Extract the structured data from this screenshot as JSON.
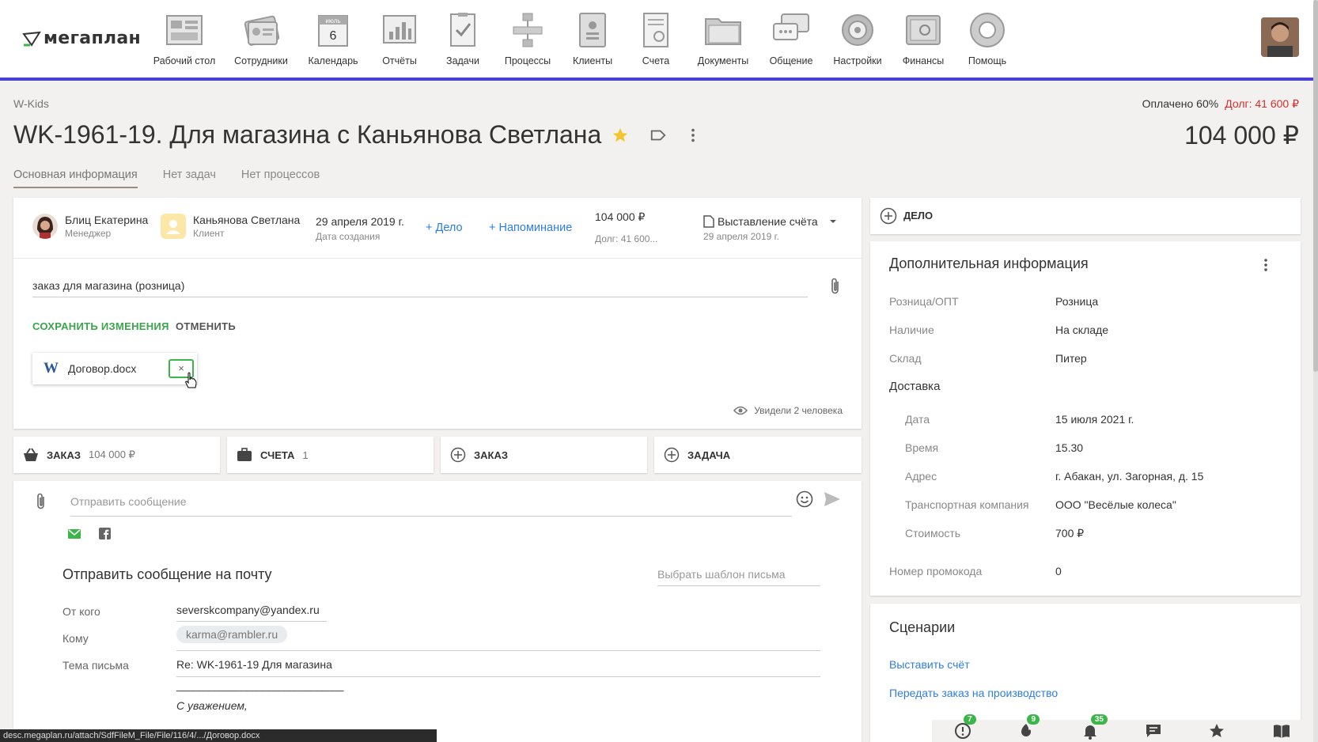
{
  "nav": {
    "logo": "мегаплан",
    "items": [
      {
        "label": "Рабочий стол",
        "icon": "desktop-icon"
      },
      {
        "label": "Сотрудники",
        "icon": "employees-icon"
      },
      {
        "label": "Календарь",
        "icon": "calendar-icon",
        "month": "июль",
        "day": "6"
      },
      {
        "label": "Отчёты",
        "icon": "reports-icon"
      },
      {
        "label": "Задачи",
        "icon": "tasks-icon"
      },
      {
        "label": "Процессы",
        "icon": "processes-icon"
      },
      {
        "label": "Клиенты",
        "icon": "clients-icon"
      },
      {
        "label": "Счета",
        "icon": "invoices-icon"
      },
      {
        "label": "Документы",
        "icon": "documents-icon"
      },
      {
        "label": "Общение",
        "icon": "chat-icon"
      },
      {
        "label": "Настройки",
        "icon": "settings-icon"
      },
      {
        "label": "Финансы",
        "icon": "finance-icon"
      },
      {
        "label": "Помощь",
        "icon": "help-icon"
      }
    ]
  },
  "header": {
    "breadcrumb": "W-Kids",
    "paid": "Оплачено 60%",
    "debt": "Долг: 41 600 ₽",
    "title": "WK-1961-19. Для магазина с Каньянова Светлана",
    "amount": "104 000 ₽"
  },
  "tabs": [
    "Основная информация",
    "Нет задач",
    "Нет процессов"
  ],
  "deal": {
    "manager_name": "Блиц Екатерина",
    "manager_role": "Менеджер",
    "client_name": "Каньянова Светлана",
    "client_role": "Клиент",
    "created_date": "29 апреля 2019 г.",
    "created_label": "Дата создания",
    "add_case": "+ Дело",
    "add_reminder": "+ Напоминание",
    "sum": "104 000 ₽",
    "sum_debt": "Долг: 41 600...",
    "stage": "Выставление счёта",
    "stage_date": "29 апреля 2019 г.",
    "description": "заказ для магазина (розница)",
    "save": "СОХРАНИТЬ ИЗМЕНЕНИЯ",
    "cancel": "ОТМЕНИТЬ",
    "file_name": "Договор.docx",
    "file_remove": "×",
    "seen": "Увидели 2 человека"
  },
  "actions": {
    "order_label": "ЗАКАЗ",
    "order_value": "104 000 ₽",
    "invoices_label": "СЧЕТА",
    "invoices_count": "1",
    "add_order": "ЗАКАЗ",
    "add_task": "ЗАДАЧА"
  },
  "message": {
    "placeholder": "Отправить сообщение",
    "mail_title": "Отправить сообщение на почту",
    "template_placeholder": "Выбрать шаблон письма",
    "from_label": "От кого",
    "from_value": "severskcompany@yandex.ru",
    "to_label": "Кому",
    "to_value": "karma@rambler.ru",
    "subject_label": "Тема письма",
    "subject_value": "Re: WK-1961-19 Для магазина",
    "signature_line": "_______________________________",
    "signature": "С уважением,"
  },
  "right": {
    "case_label": "ДЕЛО",
    "extra_title": "Дополнительная информация",
    "fields": [
      {
        "k": "Розница/ОПТ",
        "v": "Розница"
      },
      {
        "k": "Наличие",
        "v": "На складе"
      },
      {
        "k": "Склад",
        "v": "Питер"
      }
    ],
    "delivery_title": "Доставка",
    "delivery": [
      {
        "k": "Дата",
        "v": "15 июля 2021 г."
      },
      {
        "k": "Время",
        "v": "15.30"
      },
      {
        "k": "Адрес",
        "v": "г. Абакан, ул. Загорная, д. 15"
      },
      {
        "k": "Транспортная компания",
        "v": "ООО \"Весёлые колеса\""
      },
      {
        "k": "Стоимость",
        "v": "700 ₽"
      }
    ],
    "promo_label": "Номер промокода",
    "promo_value": "0",
    "scenarios_title": "Сценарии",
    "scenarios": [
      "Выставить счёт",
      "Передать заказ на производство"
    ]
  },
  "bottom": {
    "alerts": "7",
    "fire": "9",
    "notifications": "35"
  },
  "status_url": "desc.megaplan.ru/attach/SdfFileM_File/File/116/4/.../Договор.docx",
  "colors": {
    "accent": "#4a3fd4",
    "link": "#2f7de1",
    "save": "#3aa54a",
    "debt": "#d32f2f"
  }
}
